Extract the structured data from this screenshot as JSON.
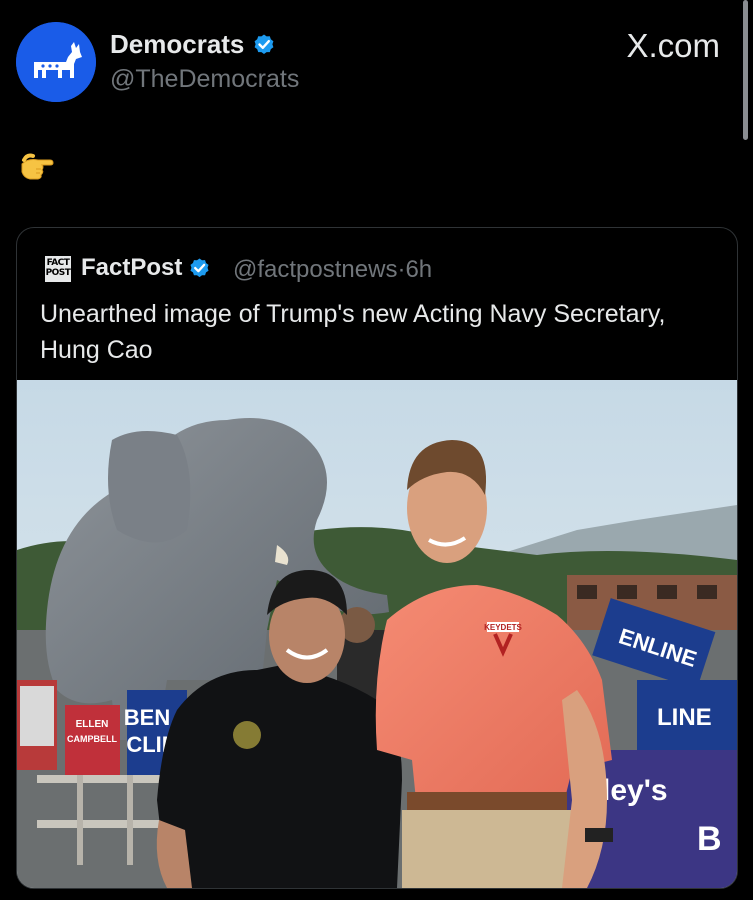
{
  "post": {
    "author_name": "Democrats",
    "author_handle": "@TheDemocrats",
    "verified_icon": "verified-badge-icon",
    "avatar_icon": "donkey-icon",
    "body_emoji_icon": "pinching-hand-icon"
  },
  "site": {
    "label": "X.com"
  },
  "quoted_post": {
    "logo_icon": "factpost-logo-icon",
    "logo_text": "FACT POST",
    "author_name": "FactPost",
    "author_handle": "@factpostnews",
    "separator": "·",
    "time": "6h",
    "text": "Unearthed image of Trump's new Acting Navy Secretary, Hung Cao",
    "image": {
      "description_icon": "photo-image",
      "sign_left_top": "ELLEN",
      "sign_left_bottom": "CAMPBELL",
      "sign_mid_top": "BEN",
      "sign_mid_bottom": "CLIN",
      "sign_right_top": "EN",
      "sign_right_top2": "LINE",
      "sign_right_bottom": "LINE",
      "banner_line1": "alley's",
      "banner_line2": "B",
      "shirt_logo": "KEYDETS"
    }
  },
  "colors": {
    "background": "#000000",
    "text_primary": "#e7e9ea",
    "text_secondary": "#71767b",
    "verified_blue": "#1d9bf0",
    "avatar_blue": "#1a5ce8",
    "card_border": "#2f3336"
  }
}
